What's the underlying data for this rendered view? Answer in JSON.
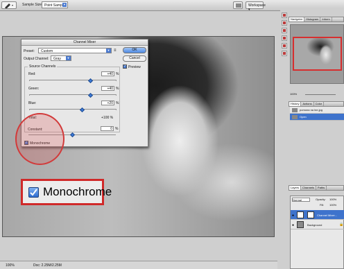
{
  "options_bar": {
    "sample_size_label": "Sample Size:",
    "sample_size_value": "Point Sample",
    "workspace_label": "Workspace ▾"
  },
  "toolbox": {
    "logo": "Ps"
  },
  "status_bar": {
    "zoom": "100%",
    "doc": "Doc: 2.25M/2.25M"
  },
  "dialog": {
    "title": "Channel Mixer",
    "preset_label": "Preset:",
    "preset_value": "Custom",
    "output_label": "Output Channel:",
    "output_value": "Gray",
    "source_channels_label": "Source Channels",
    "ok_label": "OK",
    "cancel_label": "Cancel",
    "preview_label": "Preview",
    "preview_checked": true,
    "red_label": "Red:",
    "red_value": "+40",
    "green_label": "Green:",
    "green_value": "+40",
    "blue_label": "Blue:",
    "blue_value": "+20",
    "pct": "%",
    "total_label": "Total:",
    "total_value": "+100 %",
    "constant_label": "Constant:",
    "constant_value": "0",
    "monochrome_label": "Monochrome",
    "monochrome_checked": true
  },
  "callout": {
    "label": "Monochrome"
  },
  "panels": {
    "nav_tabs": [
      "Navigator",
      "Histogram",
      "Inform"
    ],
    "nav_zoom": "100%",
    "history_tabs": [
      "History",
      "Actions",
      "Color"
    ],
    "history_items": [
      "pomona na lne.jpg",
      "Open"
    ],
    "layers_tabs": [
      "Layers",
      "Channels",
      "Paths"
    ],
    "blend_mode": "Normal",
    "opacity_label": "Opacity:",
    "opacity_value": "100%",
    "fill_label": "Fill:",
    "fill_value": "100%",
    "layers": [
      "Channel Mixer...",
      "Background"
    ]
  },
  "colors": {
    "highlight_red": "#d02929",
    "selection_blue": "#3e73cc"
  }
}
